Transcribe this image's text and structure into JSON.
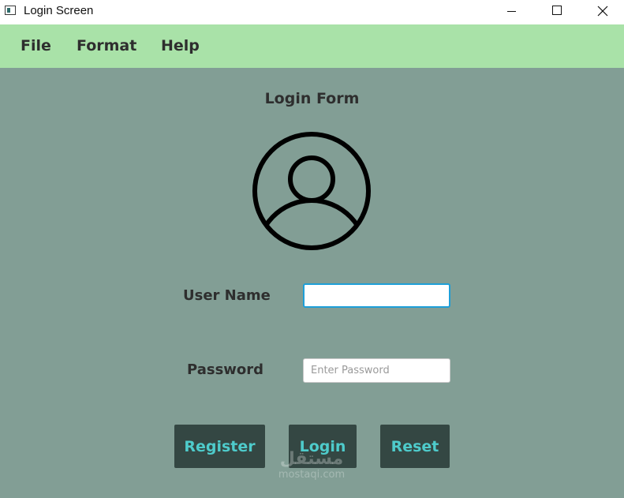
{
  "window": {
    "title": "Login Screen",
    "controls": {
      "minimize_icon": "minimize-icon",
      "maximize_icon": "maximize-icon",
      "close_icon": "close-icon"
    }
  },
  "menubar": {
    "items": [
      {
        "label": "File"
      },
      {
        "label": "Format"
      },
      {
        "label": "Help"
      }
    ]
  },
  "form": {
    "title": "Login Form",
    "avatar_icon": "user-avatar-icon",
    "username": {
      "label": "User Name",
      "value": "",
      "placeholder": ""
    },
    "password": {
      "label": "Password",
      "value": "",
      "placeholder": "Enter Password"
    },
    "buttons": {
      "register": "Register",
      "login": "Login",
      "reset": "Reset"
    }
  },
  "watermark": {
    "arabic": "مستقل",
    "latin": "mostaqi.com"
  },
  "colors": {
    "background": "#829E95",
    "menubar": "#A9E2A8",
    "button_bg": "#344743",
    "button_text": "#4ECBCB",
    "focus_border": "#1E9FD8",
    "text": "#2E2E2E"
  }
}
